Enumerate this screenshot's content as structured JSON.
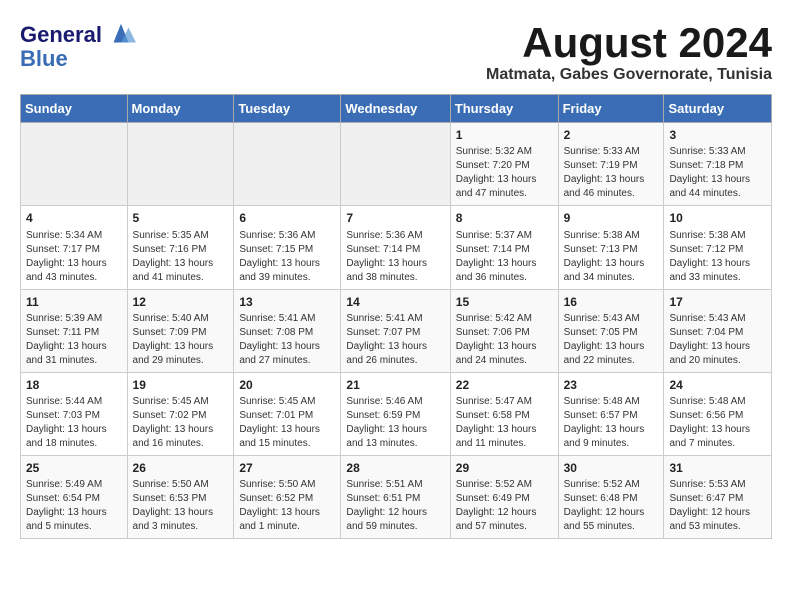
{
  "logo": {
    "line1": "General",
    "line2": "Blue"
  },
  "title": "August 2024",
  "subtitle": "Matmata, Gabes Governorate, Tunisia",
  "days_of_week": [
    "Sunday",
    "Monday",
    "Tuesday",
    "Wednesday",
    "Thursday",
    "Friday",
    "Saturday"
  ],
  "weeks": [
    [
      {
        "day": "",
        "info": ""
      },
      {
        "day": "",
        "info": ""
      },
      {
        "day": "",
        "info": ""
      },
      {
        "day": "",
        "info": ""
      },
      {
        "day": "1",
        "info": "Sunrise: 5:32 AM\nSunset: 7:20 PM\nDaylight: 13 hours and 47 minutes."
      },
      {
        "day": "2",
        "info": "Sunrise: 5:33 AM\nSunset: 7:19 PM\nDaylight: 13 hours and 46 minutes."
      },
      {
        "day": "3",
        "info": "Sunrise: 5:33 AM\nSunset: 7:18 PM\nDaylight: 13 hours and 44 minutes."
      }
    ],
    [
      {
        "day": "4",
        "info": "Sunrise: 5:34 AM\nSunset: 7:17 PM\nDaylight: 13 hours and 43 minutes."
      },
      {
        "day": "5",
        "info": "Sunrise: 5:35 AM\nSunset: 7:16 PM\nDaylight: 13 hours and 41 minutes."
      },
      {
        "day": "6",
        "info": "Sunrise: 5:36 AM\nSunset: 7:15 PM\nDaylight: 13 hours and 39 minutes."
      },
      {
        "day": "7",
        "info": "Sunrise: 5:36 AM\nSunset: 7:14 PM\nDaylight: 13 hours and 38 minutes."
      },
      {
        "day": "8",
        "info": "Sunrise: 5:37 AM\nSunset: 7:14 PM\nDaylight: 13 hours and 36 minutes."
      },
      {
        "day": "9",
        "info": "Sunrise: 5:38 AM\nSunset: 7:13 PM\nDaylight: 13 hours and 34 minutes."
      },
      {
        "day": "10",
        "info": "Sunrise: 5:38 AM\nSunset: 7:12 PM\nDaylight: 13 hours and 33 minutes."
      }
    ],
    [
      {
        "day": "11",
        "info": "Sunrise: 5:39 AM\nSunset: 7:11 PM\nDaylight: 13 hours and 31 minutes."
      },
      {
        "day": "12",
        "info": "Sunrise: 5:40 AM\nSunset: 7:09 PM\nDaylight: 13 hours and 29 minutes."
      },
      {
        "day": "13",
        "info": "Sunrise: 5:41 AM\nSunset: 7:08 PM\nDaylight: 13 hours and 27 minutes."
      },
      {
        "day": "14",
        "info": "Sunrise: 5:41 AM\nSunset: 7:07 PM\nDaylight: 13 hours and 26 minutes."
      },
      {
        "day": "15",
        "info": "Sunrise: 5:42 AM\nSunset: 7:06 PM\nDaylight: 13 hours and 24 minutes."
      },
      {
        "day": "16",
        "info": "Sunrise: 5:43 AM\nSunset: 7:05 PM\nDaylight: 13 hours and 22 minutes."
      },
      {
        "day": "17",
        "info": "Sunrise: 5:43 AM\nSunset: 7:04 PM\nDaylight: 13 hours and 20 minutes."
      }
    ],
    [
      {
        "day": "18",
        "info": "Sunrise: 5:44 AM\nSunset: 7:03 PM\nDaylight: 13 hours and 18 minutes."
      },
      {
        "day": "19",
        "info": "Sunrise: 5:45 AM\nSunset: 7:02 PM\nDaylight: 13 hours and 16 minutes."
      },
      {
        "day": "20",
        "info": "Sunrise: 5:45 AM\nSunset: 7:01 PM\nDaylight: 13 hours and 15 minutes."
      },
      {
        "day": "21",
        "info": "Sunrise: 5:46 AM\nSunset: 6:59 PM\nDaylight: 13 hours and 13 minutes."
      },
      {
        "day": "22",
        "info": "Sunrise: 5:47 AM\nSunset: 6:58 PM\nDaylight: 13 hours and 11 minutes."
      },
      {
        "day": "23",
        "info": "Sunrise: 5:48 AM\nSunset: 6:57 PM\nDaylight: 13 hours and 9 minutes."
      },
      {
        "day": "24",
        "info": "Sunrise: 5:48 AM\nSunset: 6:56 PM\nDaylight: 13 hours and 7 minutes."
      }
    ],
    [
      {
        "day": "25",
        "info": "Sunrise: 5:49 AM\nSunset: 6:54 PM\nDaylight: 13 hours and 5 minutes."
      },
      {
        "day": "26",
        "info": "Sunrise: 5:50 AM\nSunset: 6:53 PM\nDaylight: 13 hours and 3 minutes."
      },
      {
        "day": "27",
        "info": "Sunrise: 5:50 AM\nSunset: 6:52 PM\nDaylight: 13 hours and 1 minute."
      },
      {
        "day": "28",
        "info": "Sunrise: 5:51 AM\nSunset: 6:51 PM\nDaylight: 12 hours and 59 minutes."
      },
      {
        "day": "29",
        "info": "Sunrise: 5:52 AM\nSunset: 6:49 PM\nDaylight: 12 hours and 57 minutes."
      },
      {
        "day": "30",
        "info": "Sunrise: 5:52 AM\nSunset: 6:48 PM\nDaylight: 12 hours and 55 minutes."
      },
      {
        "day": "31",
        "info": "Sunrise: 5:53 AM\nSunset: 6:47 PM\nDaylight: 12 hours and 53 minutes."
      }
    ]
  ]
}
